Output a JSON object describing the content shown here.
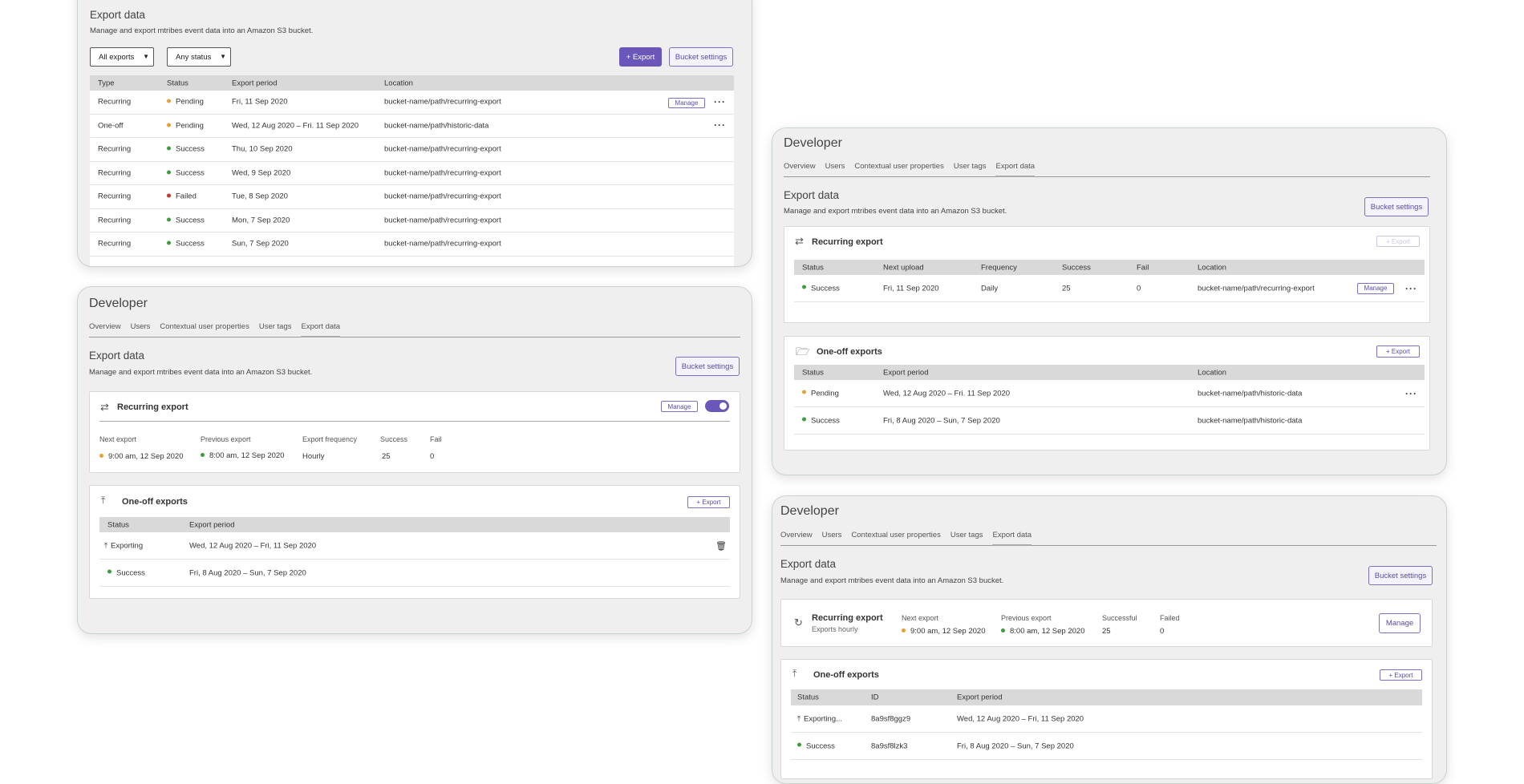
{
  "panel1": {
    "title": "Export data",
    "desc": "Manage and export mtribes event data into an Amazon S3 bucket.",
    "filter_type": "All exports",
    "filter_status": "Any status",
    "export_btn": "+ Export",
    "bucket_btn": "Bucket settings",
    "manage_btn": "Manage",
    "headers": [
      "Type",
      "Status",
      "Export period",
      "Location"
    ],
    "rows": [
      {
        "type": "Recurring",
        "status": "Pending",
        "status_kind": "pending",
        "period": "Fri, 11 Sep 2020",
        "location": "bucket-name/path/recurring-export"
      },
      {
        "type": "One-off",
        "status": "Pending",
        "status_kind": "pending",
        "period": "Wed, 12 Aug 2020 – Fri. 11 Sep 2020",
        "location": "bucket-name/path/historic-data"
      },
      {
        "type": "Recurring",
        "status": "Success",
        "status_kind": "success",
        "period": "Thu, 10 Sep 2020",
        "location": "bucket-name/path/recurring-export"
      },
      {
        "type": "Recurring",
        "status": "Success",
        "status_kind": "success",
        "period": "Wed, 9 Sep 2020",
        "location": "bucket-name/path/recurring-export"
      },
      {
        "type": "Recurring",
        "status": "Failed",
        "status_kind": "failed",
        "period": "Tue, 8 Sep 2020",
        "location": "bucket-name/path/recurring-export"
      },
      {
        "type": "Recurring",
        "status": "Success",
        "status_kind": "success",
        "period": "Mon, 7 Sep 2020",
        "location": "bucket-name/path/recurring-export"
      },
      {
        "type": "Recurring",
        "status": "Success",
        "status_kind": "success",
        "period": "Sun, 7 Sep 2020",
        "location": "bucket-name/path/recurring-export"
      }
    ]
  },
  "nav": {
    "app_title": "Developer",
    "tabs": [
      "Overview",
      "Users",
      "Contextual user properties",
      "User tags",
      "Export data"
    ]
  },
  "panel2": {
    "title": "Export data",
    "desc": "Manage and export mtribes event data into an Amazon S3 bucket.",
    "bucket_btn": "Bucket settings",
    "recurring": {
      "title": "Recurring export",
      "manage_btn": "Manage",
      "labels": [
        "Next export",
        "Previous export",
        "Export frequency",
        "Success",
        "Fail"
      ],
      "next": "9:00 am, 12 Sep 2020",
      "previous": "8:00 am, 12 Sep 2020",
      "frequency": "Hourly",
      "success": "25",
      "fail": "0"
    },
    "oneoff": {
      "title": "One-off exports",
      "export_btn": "+ Export",
      "headers": [
        "Status",
        "Export period"
      ],
      "rows": [
        {
          "status": "Exporting",
          "period": "Wed, 12 Aug 2020 – Fri, 11 Sep 2020"
        },
        {
          "status": "Success",
          "period": "Fri, 8 Aug 2020 – Sun, 7 Sep 2020"
        }
      ]
    }
  },
  "panel3": {
    "title": "Export data",
    "desc": "Manage and export mtribes event data into an Amazon S3 bucket.",
    "bucket_btn": "Bucket settings",
    "recurring": {
      "title": "Recurring export",
      "export_btn": "+ Export",
      "manage_btn": "Manage",
      "headers": [
        "Status",
        "Next upload",
        "Frequency",
        "Success",
        "Fail",
        "Location"
      ],
      "row": {
        "status": "Success",
        "next": "Fri, 11 Sep 2020",
        "frequency": "Daily",
        "success": "25",
        "fail": "0",
        "location": "bucket-name/path/recurring-export"
      }
    },
    "oneoff": {
      "title": "One-off exports",
      "export_btn": "+ Export",
      "headers": [
        "Status",
        "Export period",
        "Location"
      ],
      "rows": [
        {
          "status": "Pending",
          "period": "Wed, 12 Aug 2020 – Fri. 11 Sep 2020",
          "location": "bucket-name/path/historic-data"
        },
        {
          "status": "Success",
          "period": "Fri, 8 Aug 2020 – Sun, 7 Sep 2020",
          "location": "bucket-name/path/historic-data"
        }
      ]
    }
  },
  "panel4": {
    "title": "Export data",
    "desc": "Manage and export mtribes event data into an Amazon S3 bucket.",
    "bucket_btn": "Bucket settings",
    "recurring": {
      "title": "Recurring export",
      "subtitle": "Exports hourly",
      "labels": [
        "Next export",
        "Previous export",
        "Successful",
        "Failed"
      ],
      "next": "9:00 am, 12 Sep 2020",
      "previous": "8:00 am, 12 Sep 2020",
      "successful": "25",
      "failed": "0",
      "manage_btn": "Manage"
    },
    "oneoff": {
      "title": "One-off exports",
      "export_btn": "+ Export",
      "headers": [
        "Status",
        "ID",
        "Export period"
      ],
      "rows": [
        {
          "status": "Exporting...",
          "id": "8a9sf8ggz9",
          "period": "Wed, 12 Aug 2020 – Fri, 11 Sep 2020"
        },
        {
          "status": "Success",
          "id": "8a9sf8lzk3",
          "period": "Fri, 8 Aug 2020 – Sun, 7 Sep 2020"
        }
      ]
    }
  },
  "colors": {
    "accent": "#6a57b9",
    "pending": "#e8a03a",
    "success": "#3e9b3e",
    "failed": "#c2392b"
  }
}
